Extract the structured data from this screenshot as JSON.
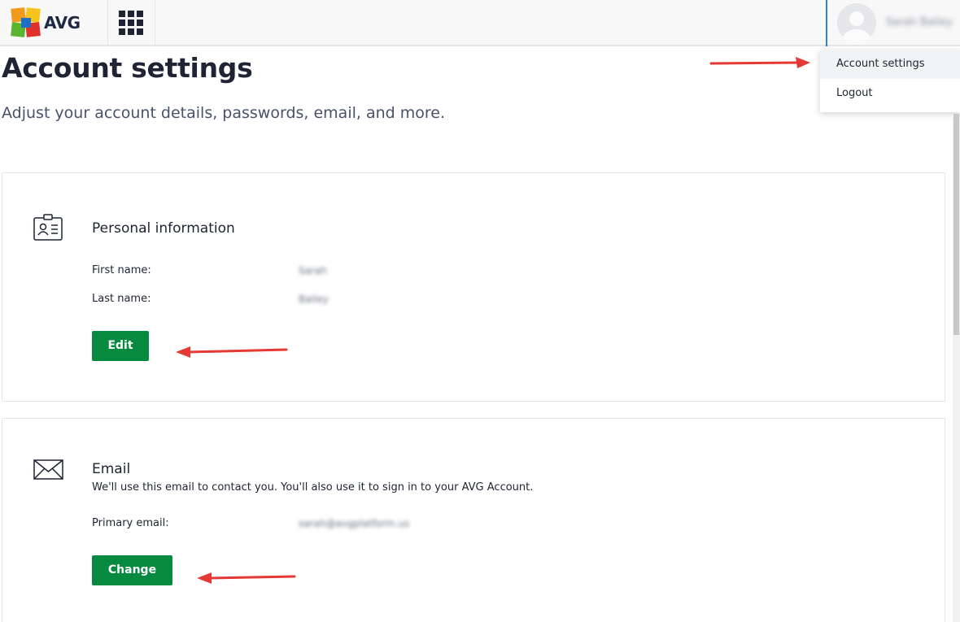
{
  "header": {
    "brand": "AVG",
    "apps_icon": "apps-grid-icon",
    "user_name": "Sarah Bailey"
  },
  "dropdown": {
    "items": [
      {
        "label": "Account settings",
        "active": true
      },
      {
        "label": "Logout",
        "active": false
      }
    ]
  },
  "page": {
    "title": "Account settings",
    "subtitle": "Adjust your account details, passwords, email, and more."
  },
  "personal": {
    "icon": "id-badge-icon",
    "title": "Personal information",
    "first_name_label": "First name:",
    "first_name_value": "Sarah",
    "last_name_label": "Last name:",
    "last_name_value": "Bailey",
    "edit_label": "Edit"
  },
  "email": {
    "icon": "envelope-icon",
    "title": "Email",
    "description": "We'll use this email to contact you. You'll also use it to sign in to your AVG Account.",
    "primary_label": "Primary email:",
    "primary_value": "sarah@avgplatform.us",
    "change_label": "Change"
  },
  "colors": {
    "button_green": "#058a3f",
    "annotation_red": "#e53935",
    "user_border_blue": "#2e84d6"
  }
}
